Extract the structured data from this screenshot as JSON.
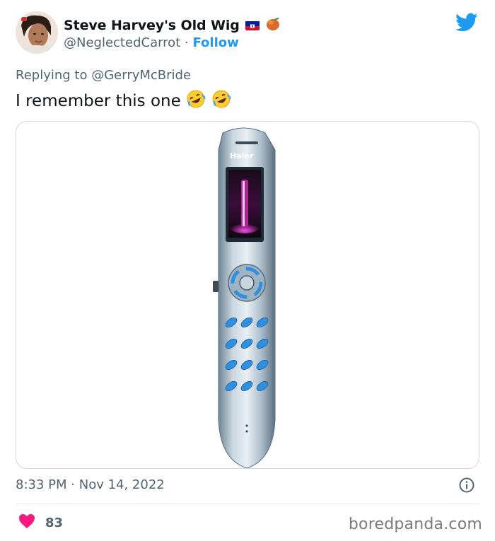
{
  "author": {
    "display_name": "Steve Harvey's Old Wig",
    "handle": "@NeglectedCarrot",
    "separator": "·",
    "follow_label": "Follow"
  },
  "reply": {
    "prefix": "Replying to",
    "user": "@GerryMcBride"
  },
  "tweet": {
    "text": "I remember this one",
    "emojis": [
      "rolling-on-floor-laughing",
      "rolling-on-floor-laughing"
    ]
  },
  "media": {
    "phone_brand": "Haier"
  },
  "meta": {
    "time": "8:33 PM",
    "separator": "·",
    "date": "Nov 14, 2022"
  },
  "engagement": {
    "likes": "83"
  },
  "watermark": "boredpanda.com",
  "colors": {
    "accent": "#1d9bf0",
    "like_heart": "#f91880",
    "secondary_text": "#536471"
  }
}
